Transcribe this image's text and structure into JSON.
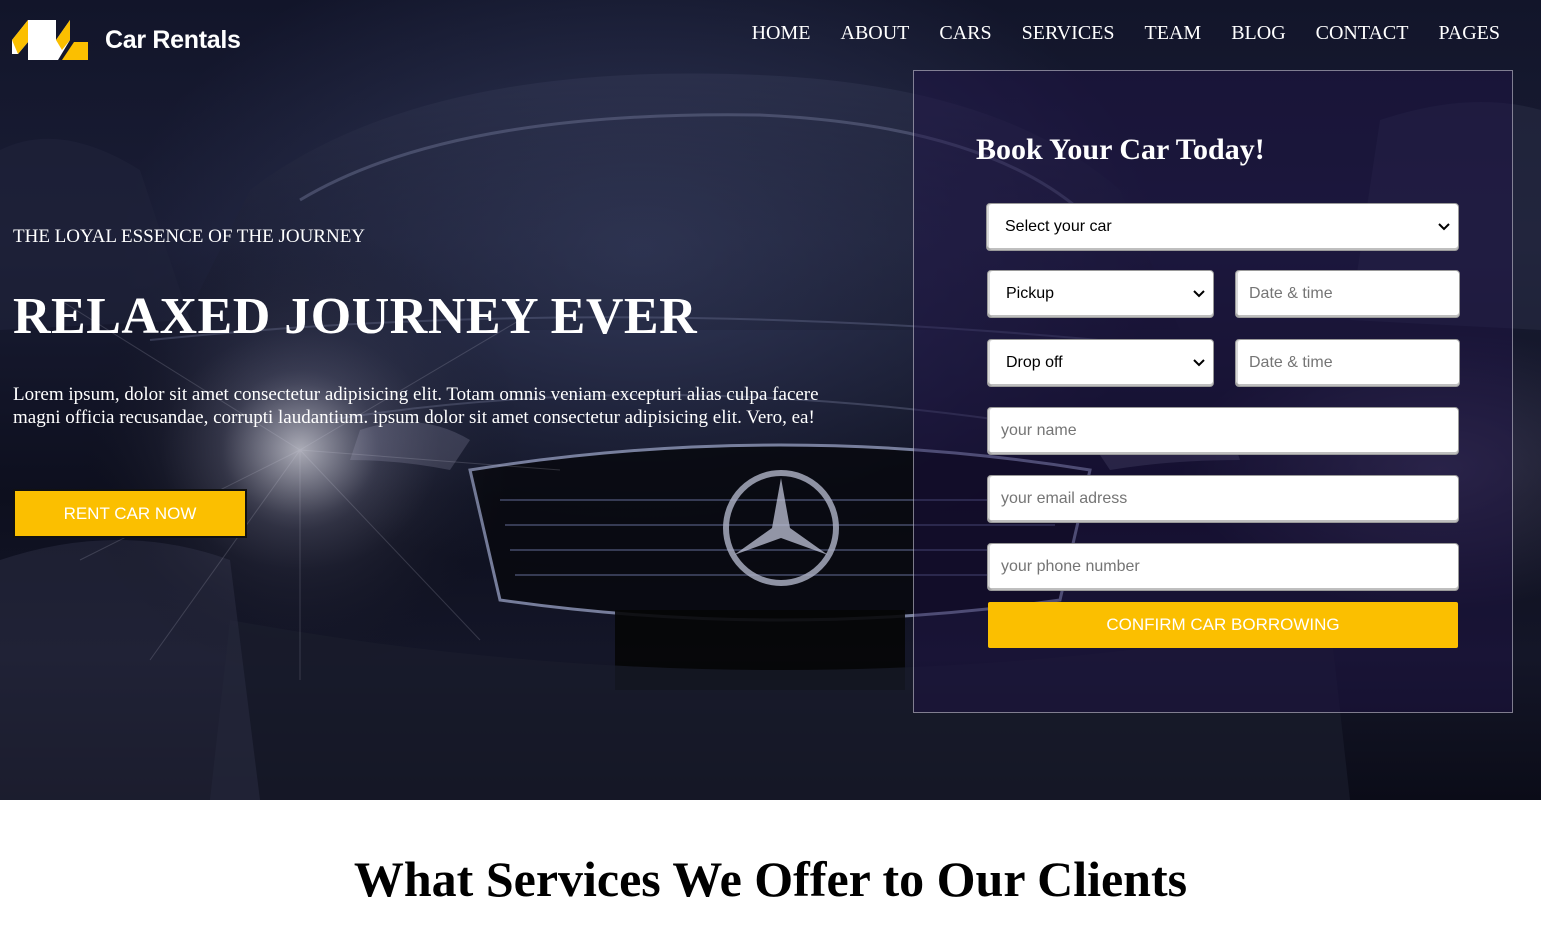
{
  "header": {
    "logo_text": "Car Rentals",
    "nav": [
      "HOME",
      "ABOUT",
      "CARS",
      "SERVICES",
      "TEAM",
      "BLOG",
      "CONTACT",
      "PAGES"
    ]
  },
  "hero": {
    "tagline": "THE LOYAL ESSENCE OF THE JOURNEY",
    "headline": "RELAXED JOURNEY EVER",
    "intro": "Lorem ipsum, dolor sit amet consectetur adipisicing elit. Totam omnis veniam excepturi alias culpa facere magni officia recusandae, corrupti laudantium. ipsum dolor sit amet consectetur adipisicing elit. Vero, ea!",
    "cta_label": "RENT CAR NOW"
  },
  "booking": {
    "title": "Book Your Car Today!",
    "car_select": "Select your car",
    "pickup_select": "Pickup",
    "pickup_datetime_placeholder": "Date & time",
    "dropoff_select": "Drop off",
    "dropoff_datetime_placeholder": "Date & time",
    "name_placeholder": "your name",
    "email_placeholder": "your email adress",
    "phone_placeholder": "your phone number",
    "confirm_label": "CONFIRM CAR BORROWING"
  },
  "services": {
    "title": "What Services We Offer to Our Clients"
  },
  "colors": {
    "accent": "#fbbf00",
    "hero_dark": "#12152a",
    "text_light": "#ffffff"
  }
}
